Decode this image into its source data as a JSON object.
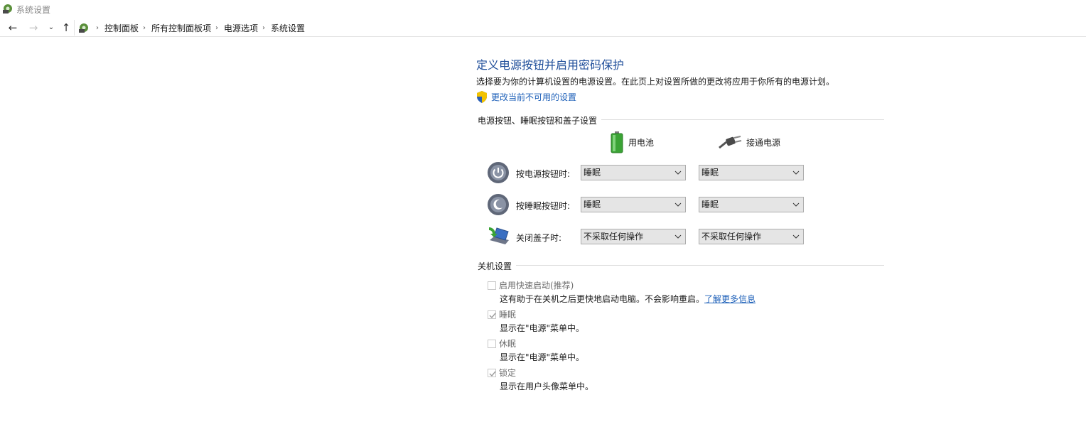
{
  "window": {
    "title": "系统设置"
  },
  "breadcrumbs": [
    "控制面板",
    "所有控制面板项",
    "电源选项",
    "系统设置"
  ],
  "page": {
    "heading": "定义电源按钮并启用密码保护",
    "description": "选择要为你的计算机设置的电源设置。在此页上对设置所做的更改将应用于你所有的电源计划。",
    "change_link": "更改当前不可用的设置"
  },
  "power_section": {
    "title": "电源按钮、睡眠按钮和盖子设置",
    "col_battery": "用电池",
    "col_plugged": "接通电源",
    "rows": [
      {
        "label": "按电源按钮时:",
        "battery": "睡眠",
        "plugged": "睡眠",
        "icon": "power-button-icon"
      },
      {
        "label": "按睡眠按钮时:",
        "battery": "睡眠",
        "plugged": "睡眠",
        "icon": "sleep-button-icon"
      },
      {
        "label": "关闭盖子时:",
        "battery": "不采取任何操作",
        "plugged": "不采取任何操作",
        "icon": "laptop-lid-icon"
      }
    ]
  },
  "shutdown_section": {
    "title": "关机设置",
    "items": [
      {
        "label": "启用快速启动(推荐)",
        "checked": false,
        "desc": "这有助于在关机之后更快地启动电脑。不会影响重启。",
        "link": "了解更多信息"
      },
      {
        "label": "睡眠",
        "checked": true,
        "desc": "显示在\"电源\"菜单中。"
      },
      {
        "label": "休眠",
        "checked": false,
        "desc": "显示在\"电源\"菜单中。"
      },
      {
        "label": "锁定",
        "checked": true,
        "desc": "显示在用户头像菜单中。"
      }
    ]
  },
  "colors": {
    "heading": "#1f4e9a",
    "link": "#1c5fb8",
    "dropdown_bg": "#e5e5e5"
  }
}
